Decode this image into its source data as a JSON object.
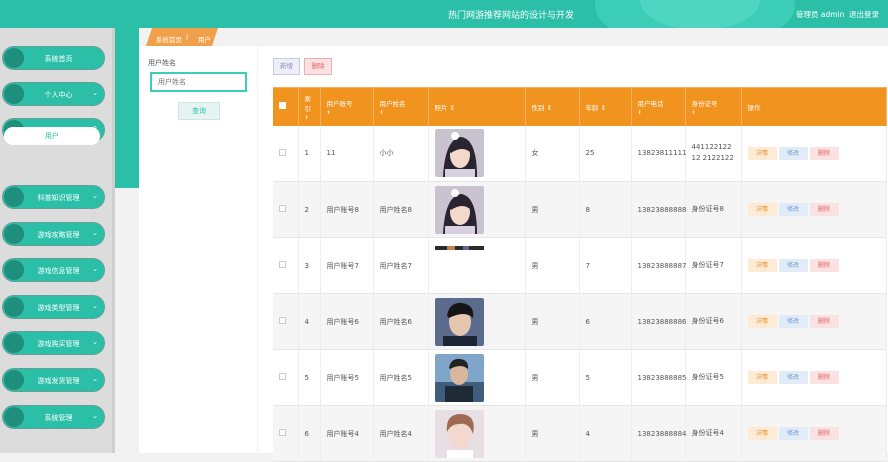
{
  "header": {
    "title": "热门网游推荐网站的设计与开发",
    "user": "管理员 admin",
    "logout": "退出登录"
  },
  "sidebar": {
    "items": [
      {
        "label": "系统首页",
        "chevron": ""
      },
      {
        "label": "个人中心",
        "chevron": "⌄"
      },
      {
        "label": "用户管理",
        "chevron": "⌃"
      },
      {
        "label": "科普知识管理",
        "chevron": "⌄"
      },
      {
        "label": "游戏攻略管理",
        "chevron": "⌄"
      },
      {
        "label": "游戏信息管理",
        "chevron": "⌄"
      },
      {
        "label": "游戏类型管理",
        "chevron": "⌄"
      },
      {
        "label": "游戏购买管理",
        "chevron": "⌄"
      },
      {
        "label": "游戏发货管理",
        "chevron": "⌄"
      },
      {
        "label": "系统管理",
        "chevron": "⌄"
      }
    ],
    "submenu": "用户"
  },
  "breadcrumb": {
    "home": "系统首页",
    "sep": "|",
    "current": "用户"
  },
  "search": {
    "label": "用户姓名",
    "placeholder": "用户姓名",
    "button": "查询"
  },
  "toolbar": {
    "add": "新增",
    "delete": "删除"
  },
  "table": {
    "headers": [
      "",
      "索引",
      "用户账号",
      "用户姓名",
      "照片",
      "性别",
      "年龄",
      "用户电话",
      "身份证号",
      "操作"
    ],
    "rows": [
      {
        "index": "1",
        "account": "11",
        "name": "小小",
        "photo": "girl",
        "gender": "女",
        "age": "25",
        "phone": "13823811111",
        "idcard": "44112212212 2122122"
      },
      {
        "index": "2",
        "account": "用户账号8",
        "name": "用户姓名8",
        "photo": "girl",
        "gender": "男",
        "age": "8",
        "phone": "13823888888",
        "idcard": "身份证号8"
      },
      {
        "index": "3",
        "account": "用户账号7",
        "name": "用户姓名7",
        "photo": "strip",
        "gender": "男",
        "age": "7",
        "phone": "13823888887",
        "idcard": "身份证号7"
      },
      {
        "index": "4",
        "account": "用户账号6",
        "name": "用户姓名6",
        "photo": "man1",
        "gender": "男",
        "age": "6",
        "phone": "13823888886",
        "idcard": "身份证号6"
      },
      {
        "index": "5",
        "account": "用户账号5",
        "name": "用户姓名5",
        "photo": "man2",
        "gender": "男",
        "age": "5",
        "phone": "13823888885",
        "idcard": "身份证号5"
      },
      {
        "index": "6",
        "account": "用户账号4",
        "name": "用户姓名4",
        "photo": "man3",
        "gender": "男",
        "age": "4",
        "phone": "13823888884",
        "idcard": "身份证号4"
      }
    ],
    "actions": {
      "detail": "详情",
      "edit": "修改",
      "delete": "删除"
    }
  },
  "colors": {
    "accent": "#2bbfa8",
    "header_orange": "#f0931f"
  }
}
